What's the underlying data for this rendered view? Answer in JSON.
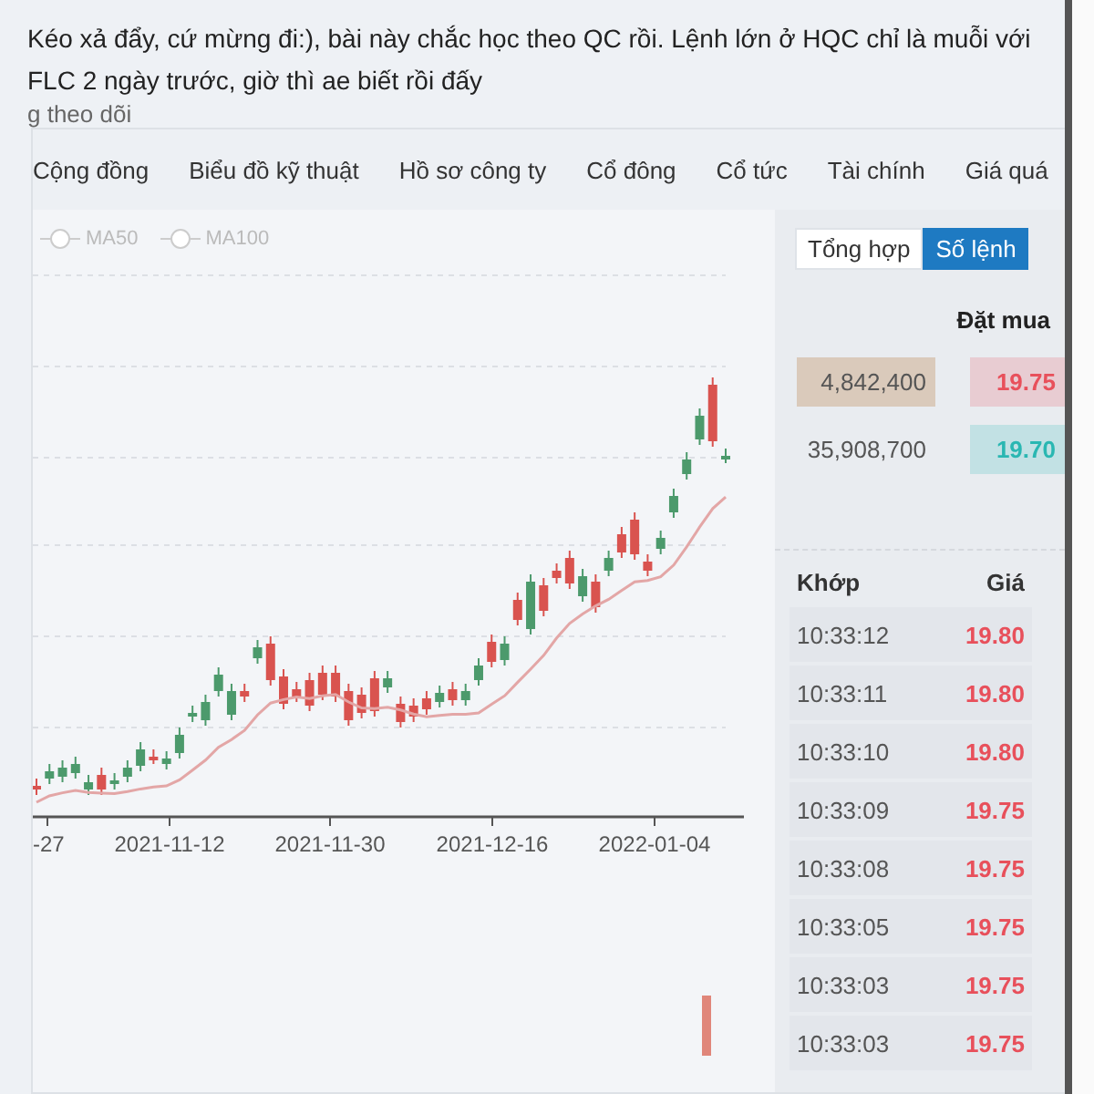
{
  "comment": {
    "text": "Kéo xả đẩy, cứ mừng đi:), bài này chắc học theo QC rồi. Lệnh lớn ở HQC chỉ là muỗi với FLC 2 ngày trước, giờ thì ae biết rồi đấy"
  },
  "follow_label": "g theo dõi",
  "nav_tabs": [
    {
      "label": "Cộng đồng"
    },
    {
      "label": "Biểu đồ kỹ thuật"
    },
    {
      "label": "Hồ sơ công ty"
    },
    {
      "label": "Cổ đông"
    },
    {
      "label": "Cổ tức"
    },
    {
      "label": "Tài chính"
    },
    {
      "label": "Giá quá"
    }
  ],
  "chart": {
    "legend": [
      {
        "label": "MA50"
      },
      {
        "label": "MA100"
      }
    ],
    "x_axis_labels": [
      "-27",
      "2021-11-12",
      "2021-11-30",
      "2021-12-16",
      "2022-01-04"
    ]
  },
  "order_panel": {
    "toggle": [
      {
        "label": "Tổng hợp",
        "selected": false
      },
      {
        "label": "Số lệnh",
        "selected": true
      }
    ],
    "bid_header": "Đặt mua",
    "bids": [
      {
        "volume": "4,842,400",
        "price": "19.75",
        "color": "#e8505b",
        "highlighted": true
      },
      {
        "volume": "35,908,700",
        "price": "19.70",
        "color": "#2ab7b2",
        "highlighted": false
      }
    ],
    "trades_header": {
      "time": "Khớp",
      "price": "Giá"
    },
    "trades": [
      {
        "time": "10:33:12",
        "price": "19.80",
        "color": "#e8505b"
      },
      {
        "time": "10:33:11",
        "price": "19.80",
        "color": "#e8505b"
      },
      {
        "time": "10:33:10",
        "price": "19.80",
        "color": "#e8505b"
      },
      {
        "time": "10:33:09",
        "price": "19.75",
        "color": "#e8505b"
      },
      {
        "time": "10:33:08",
        "price": "19.75",
        "color": "#e8505b"
      },
      {
        "time": "10:33:05",
        "price": "19.75",
        "color": "#e8505b"
      },
      {
        "time": "10:33:03",
        "price": "19.75",
        "color": "#e8505b"
      },
      {
        "time": "10:33:03",
        "price": "19.75",
        "color": "#e8505b"
      }
    ]
  }
}
